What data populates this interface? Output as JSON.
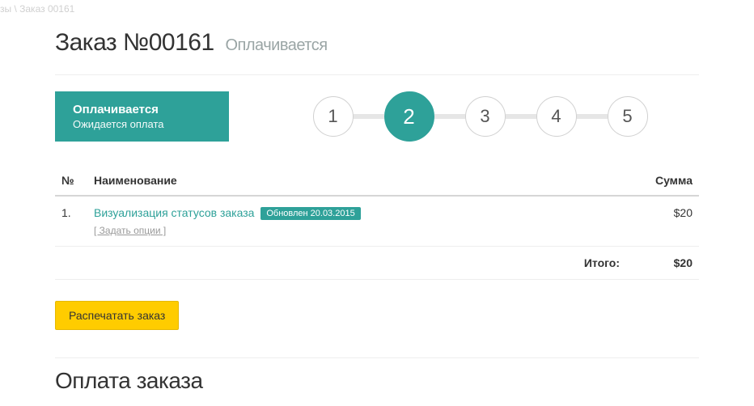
{
  "breadcrumb": "зы \\ Заказ 00161",
  "title_main": "Заказ №00161",
  "title_status": "Оплачивается",
  "status_box": {
    "main": "Оплачивается",
    "sub": "Ожидается оплата"
  },
  "steps": [
    "1",
    "2",
    "3",
    "4",
    "5"
  ],
  "active_step_index": 1,
  "table": {
    "headers": {
      "num": "№",
      "name": "Наименование",
      "sum": "Сумма"
    },
    "items": [
      {
        "num": "1.",
        "name": "Визуализация статусов заказа",
        "badge": "Обновлен 20.03.2015",
        "options": "[ Задать опции ]",
        "sum": "$20"
      }
    ],
    "total_label": "Итого:",
    "total_value": "$20"
  },
  "print_button": "Распечатать заказ",
  "payment_title": "Оплата заказа"
}
